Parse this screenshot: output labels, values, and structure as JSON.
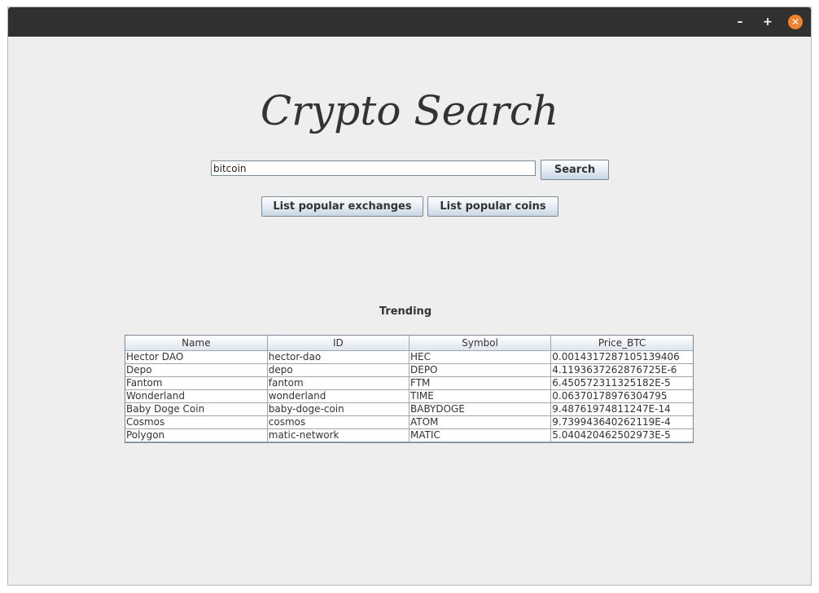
{
  "window": {
    "minimize_glyph": "–",
    "maximize_glyph": "+",
    "close_glyph": "✕",
    "close_color": "#f0812f"
  },
  "app": {
    "title": "Crypto Search"
  },
  "search": {
    "value": "bitcoin",
    "button_label": "Search"
  },
  "actions": {
    "exchanges_label": "List popular exchanges",
    "coins_label": "List popular coins"
  },
  "trending": {
    "label": "Trending",
    "columns": [
      "Name",
      "ID",
      "Symbol",
      "Price_BTC"
    ],
    "rows": [
      [
        "Hector DAO",
        "hector-dao",
        "HEC",
        "0.0014317287105139406"
      ],
      [
        "Depo",
        "depo",
        "DEPO",
        "4.1193637262876725E-6"
      ],
      [
        "Fantom",
        "fantom",
        "FTM",
        "6.450572311325182E-5"
      ],
      [
        "Wonderland",
        "wonderland",
        "TIME",
        "0.06370178976304795"
      ],
      [
        "Baby Doge Coin",
        "baby-doge-coin",
        "BABYDOGE",
        "9.48761974811247E-14"
      ],
      [
        "Cosmos",
        "cosmos",
        "ATOM",
        "9.739943640262119E-4"
      ],
      [
        "Polygon",
        "matic-network",
        "MATIC",
        "5.040420462502973E-5"
      ]
    ]
  }
}
